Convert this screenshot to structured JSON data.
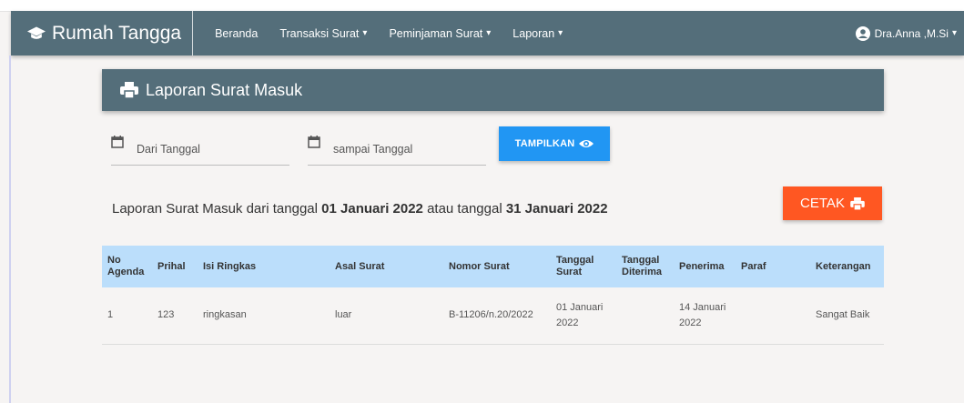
{
  "navbar": {
    "brand": "Rumah Tangga",
    "items": [
      {
        "label": "Beranda",
        "dropdown": false
      },
      {
        "label": "Transaksi Surat",
        "dropdown": true
      },
      {
        "label": "Peminjaman Surat",
        "dropdown": true
      },
      {
        "label": "Laporan",
        "dropdown": true
      }
    ],
    "user": "Dra.Anna ,M.Si"
  },
  "header": {
    "title": "Laporan Surat Masuk",
    "icon": "print-icon"
  },
  "filters": {
    "from_placeholder": "Dari Tanggal",
    "to_placeholder": "sampai Tanggal",
    "button_label": "TAMPILKAN"
  },
  "report": {
    "prefix": "Laporan Surat Masuk dari tanggal ",
    "date_from": "01 Januari 2022",
    "middle": " atau tanggal ",
    "date_to": "31 Januari 2022"
  },
  "print_button": "CETAK",
  "table": {
    "columns": [
      "No Agenda",
      "Prihal",
      "Isi Ringkas",
      "Asal Surat",
      "Nomor Surat",
      "Tanggal Surat",
      "Tanggal Diterima",
      "Penerima",
      "Paraf",
      "Keterangan"
    ],
    "rows": [
      [
        "1",
        "123",
        "ringkasan",
        "luar",
        "B-11206/n.20/2022",
        "01 Januari 2022",
        "",
        "14 Januari 2022",
        "",
        "Sangat Baik"
      ]
    ]
  },
  "colors": {
    "primary": "#546e7a",
    "accent_blue": "#2196f3",
    "accent_orange": "#ff5722",
    "table_header": "#bbdefb"
  }
}
